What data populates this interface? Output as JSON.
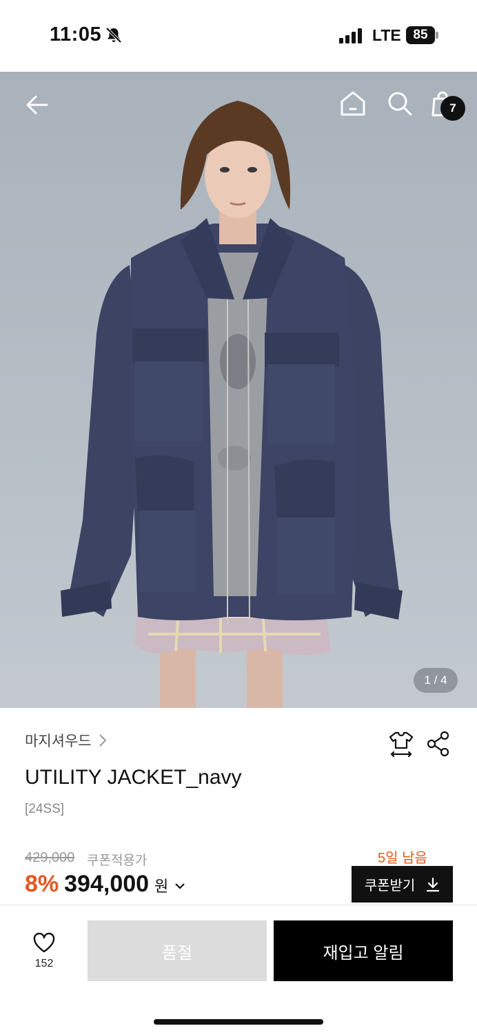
{
  "status_bar": {
    "time": "11:05",
    "network": "LTE",
    "battery": "85",
    "icons": [
      "bell-slash-icon",
      "signal-icon"
    ]
  },
  "gallery": {
    "counter": "1 / 4",
    "cart_count": "7",
    "icons": [
      "back-arrow-icon",
      "home-icon",
      "search-icon",
      "shopping-bag-icon"
    ],
    "image_description_colors": {
      "background": "#b2bac2",
      "jacket": "#3b4262"
    }
  },
  "product": {
    "brand": "마지셔우드",
    "name": "UTILITY JACKET_navy",
    "season": "[24SS]",
    "original_price": "429,000",
    "coupon_note": "쿠폰적용가",
    "days_left": "5일 남음",
    "discount_rate": "8%",
    "sale_price": "394,000",
    "currency": "원",
    "coupon_button": "쿠폰받기"
  },
  "actions": {
    "like_count": "152",
    "soldout_label": "품절",
    "restock_label": "재입고 알림"
  },
  "colors": {
    "accent": "#e4561f",
    "primary_button": "#000000",
    "disabled_button": "#dcdcdc"
  }
}
